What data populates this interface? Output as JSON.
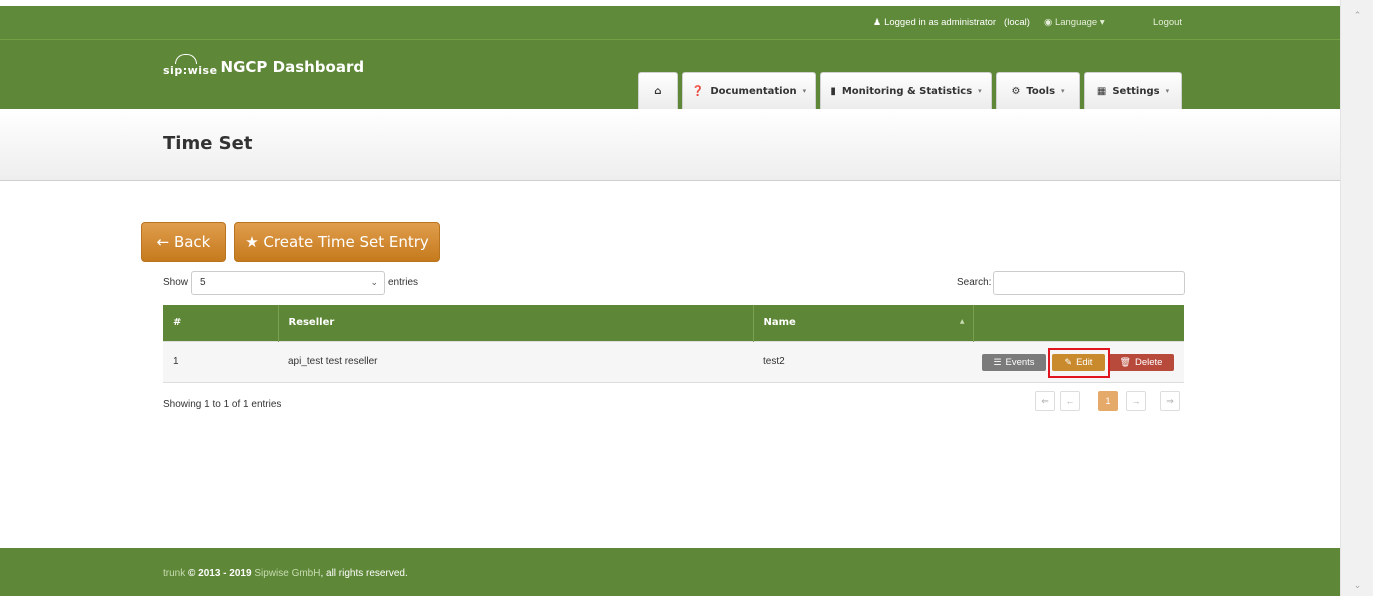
{
  "userbar": {
    "logged_in_text": "Logged in as administrator",
    "realm": "(local)",
    "language": "Language",
    "logout": "Logout"
  },
  "brand": {
    "sip": "sip:wise",
    "title": "NGCP Dashboard"
  },
  "nav": {
    "home_icon": "⌂",
    "documentation": "Documentation",
    "monitoring": "Monitoring & Statistics",
    "tools": "Tools",
    "settings": "Settings"
  },
  "page": {
    "title": "Time Set"
  },
  "actions": {
    "back": "← Back",
    "create": "★ Create Time Set Entry"
  },
  "table_controls": {
    "show_label": "Show",
    "page_size": "5",
    "entries_label": "entries",
    "search_label": "Search:"
  },
  "table": {
    "headers": [
      "#",
      "Reseller",
      "Name",
      ""
    ],
    "rows": [
      {
        "id": "1",
        "reseller": "api_test test reseller",
        "name": "test2"
      }
    ],
    "row_actions": {
      "events": "Events",
      "edit": "Edit",
      "delete": "Delete"
    }
  },
  "pagination": {
    "info": "Showing 1 to 1 of 1 entries",
    "first": "⇐",
    "prev": "←",
    "current": "1",
    "next": "→",
    "last": "⇒"
  },
  "footer": {
    "version": "trunk",
    "copyright": "© 2013 - 2019",
    "company": "Sipwise GmbH",
    "rights": ", all rights reserved."
  },
  "colors": {
    "brand_green": "#5e8738",
    "accent_orange": "#c98a2e",
    "delete_red": "#b84a3c",
    "highlight_red": "#e0151f"
  }
}
